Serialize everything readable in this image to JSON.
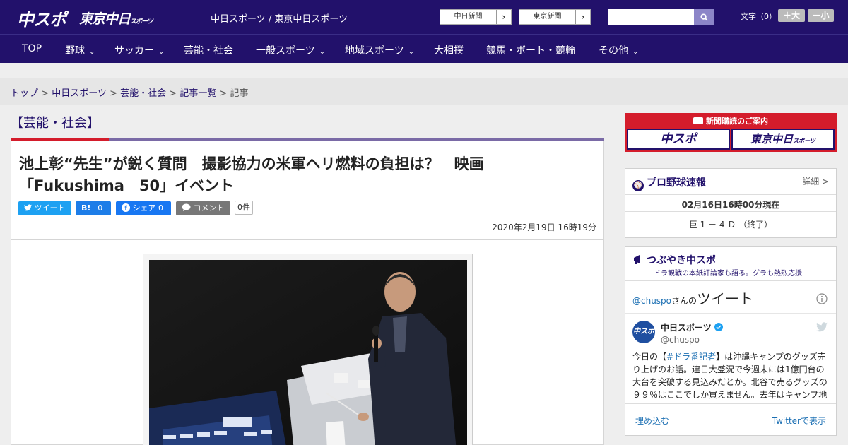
{
  "header": {
    "logo_main": "中スポ",
    "logo_tokyo": "東京中日",
    "logo_tokyo_small": "スポーツ",
    "site_links": "中日スポーツ / 東京中日スポーツ",
    "paper_links": [
      {
        "label": "中日新聞",
        "arrow": "›"
      },
      {
        "label": "東京新聞",
        "arrow": "›"
      }
    ],
    "search_placeholder": "",
    "fontsize_label": "文字（0）",
    "fontsize_up": "＋大",
    "fontsize_down": "－小"
  },
  "nav": {
    "items": [
      {
        "label": "TOP",
        "has_menu": false
      },
      {
        "label": "野球",
        "has_menu": true
      },
      {
        "label": "サッカー",
        "has_menu": true
      },
      {
        "label": "芸能・社会",
        "has_menu": false
      },
      {
        "label": "一般スポーツ",
        "has_menu": true
      },
      {
        "label": "地域スポーツ",
        "has_menu": true
      },
      {
        "label": "大相撲",
        "has_menu": false
      },
      {
        "label": "競馬・ボート・競輪",
        "has_menu": false
      },
      {
        "label": "その他",
        "has_menu": true
      }
    ],
    "chevron": "⌄"
  },
  "breadcrumb": {
    "items": [
      "トップ",
      "中日スポーツ",
      "芸能・社会",
      "記事一覧"
    ],
    "separator": ">",
    "current": "記事"
  },
  "article": {
    "category": "【芸能・社会】",
    "headline_line1": "池上彰“先生”が鋭く質問　撮影協力の米軍ヘリ燃料の負担は？　映画",
    "headline_line2": "「Fukushima　50」イベント",
    "share": {
      "tweet": "ツイート",
      "hatena": "B!",
      "hatena_count": "0",
      "facebook": "シェア",
      "facebook_count": "0",
      "comment": "コメント",
      "comment_count": "0件"
    },
    "datetime": "2020年2月19日 16時19分"
  },
  "sidebar": {
    "ad": {
      "title": "新聞購読のご案内",
      "logo_chuspo": "中スポ",
      "logo_tokyo": "東京中日",
      "logo_tokyo_small": "スポーツ"
    },
    "baseball": {
      "title": "プロ野球速報",
      "detail": "詳細 >",
      "time": "02月16日16時00分現在",
      "score": "巨 1 － 4 Ｄ （終了）"
    },
    "tweets": {
      "title": "つぶやき中スポ",
      "subtitle": "ドラ観戦の本紙評論家も語る。グラも熱烈応援",
      "handle_prefix": "@chuspo",
      "handle_suffix": "さんの",
      "tweet_word": "ツイート",
      "account_name": "中日スポーツ",
      "account_handle": "@chuspo",
      "body_pre": "今日の【",
      "body_tag": "#ドラ番記者",
      "body_post": "】は沖縄キャンプのグッズ売り上げのお話。連日大盛況で今週末には1億円台の大台を突破する見込みだとか。北谷で売るグッズの９９％はここでしか買えません。去年はキャンプ地",
      "embed": "埋め込む",
      "view_on_twitter": "Twitterで表示"
    }
  },
  "colors": {
    "brand_navy": "#22116b",
    "accent_red": "#d41c2b",
    "twitter_blue": "#1da1f2",
    "facebook_blue": "#1877f2"
  }
}
